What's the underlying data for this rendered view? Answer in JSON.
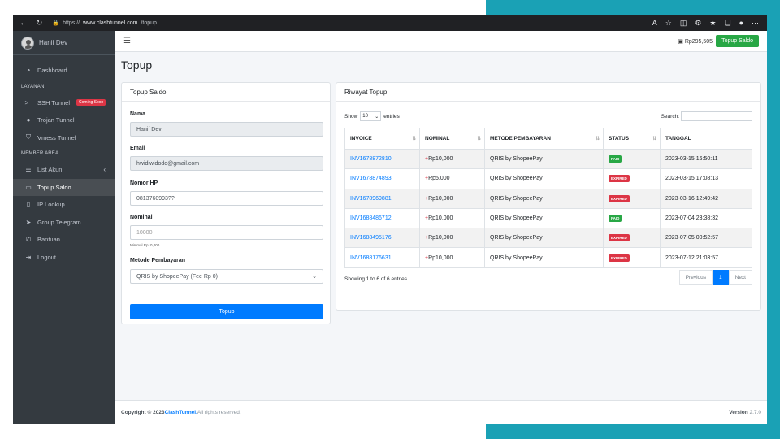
{
  "browser": {
    "url_prefix": "https://",
    "url_host": "www.clashtunnel.com",
    "url_path": "/topup"
  },
  "sidebar": {
    "user_name": "Hanif Dev",
    "items": [
      {
        "label": "Dashboard",
        "icon": "gauge-icon"
      },
      {
        "header": "LAYANAN"
      },
      {
        "label": "SSH Tunnel",
        "icon": "terminal-icon",
        "badge": "Coming Soon"
      },
      {
        "label": "Trojan Tunnel",
        "icon": "user-secret-icon"
      },
      {
        "label": "Vmess Tunnel",
        "icon": "shield-icon"
      },
      {
        "header": "MEMBER AREA"
      },
      {
        "label": "List Akun",
        "icon": "list-icon"
      },
      {
        "label": "Topup Saldo",
        "icon": "wallet-icon"
      },
      {
        "label": "IP Lookup",
        "icon": "ip-icon"
      },
      {
        "label": "Group Telegram",
        "icon": "telegram-icon"
      },
      {
        "label": "Bantuan",
        "icon": "phone-icon"
      },
      {
        "label": "Logout",
        "icon": "logout-icon"
      }
    ]
  },
  "topbar": {
    "saldo": "Rp295,505",
    "topup_button": "Topup Saldo"
  },
  "page": {
    "title": "Topup"
  },
  "form": {
    "card_title": "Topup Saldo",
    "nama_label": "Nama",
    "nama_value": "Hanif Dev",
    "email_label": "Email",
    "email_value": "hwidiwidodo@gmail.com",
    "hp_label": "Nomor HP",
    "hp_value": "0813760993??",
    "nominal_label": "Nominal",
    "nominal_placeholder": "10000",
    "nominal_hint": "Minimal Rp10,000",
    "metode_label": "Metode Pembayaran",
    "metode_value": "QRIS by ShopeePay (Fee Rp 0)",
    "submit": "Topup"
  },
  "history": {
    "card_title": "Riwayat Topup",
    "show_label": "Show",
    "show_value": "10",
    "entries_label": "entries",
    "search_label": "Search:",
    "columns": [
      "INVOICE",
      "NOMINAL",
      "METODE PEMBAYARAN",
      "STATUS",
      "TANGGAL"
    ],
    "rows": [
      {
        "invoice": "INV1678872810",
        "nominal": "Rp10,000",
        "metode": "QRIS by ShopeePay",
        "status": "PAID",
        "tanggal": "2023-03-15 16:50:11"
      },
      {
        "invoice": "INV1678874893",
        "nominal": "Rp5,000",
        "metode": "QRIS by ShopeePay",
        "status": "EXPIRED",
        "tanggal": "2023-03-15 17:08:13"
      },
      {
        "invoice": "INV1678969881",
        "nominal": "Rp10,000",
        "metode": "QRIS by ShopeePay",
        "status": "EXPIRED",
        "tanggal": "2023-03-16 12:49:42"
      },
      {
        "invoice": "INV1688486712",
        "nominal": "Rp10,000",
        "metode": "QRIS by ShopeePay",
        "status": "PAID",
        "tanggal": "2023-07-04 23:38:32"
      },
      {
        "invoice": "INV1688495176",
        "nominal": "Rp10,000",
        "metode": "QRIS by ShopeePay",
        "status": "EXPIRED",
        "tanggal": "2023-07-05 00:52:57"
      },
      {
        "invoice": "INV1688176631",
        "nominal": "Rp10,000",
        "metode": "QRIS by ShopeePay",
        "status": "EXPIRED",
        "tanggal": "2023-07-12 21:03:57"
      }
    ],
    "info": "Showing 1 to 6 of 6 entries",
    "prev": "Previous",
    "page": "1",
    "next": "Next"
  },
  "footer": {
    "copyright": "Copyright © 2023 ",
    "brand": "ClashTunnel.",
    "rights": " All rights reserved.",
    "version_label": "Version ",
    "version": "2.7.0"
  },
  "colors": {
    "sidebar": "#343a40",
    "accent_blue": "#007bff",
    "accent_green": "#28a745",
    "danger": "#dc3545",
    "backdrop_teal": "#1aa1b5"
  }
}
